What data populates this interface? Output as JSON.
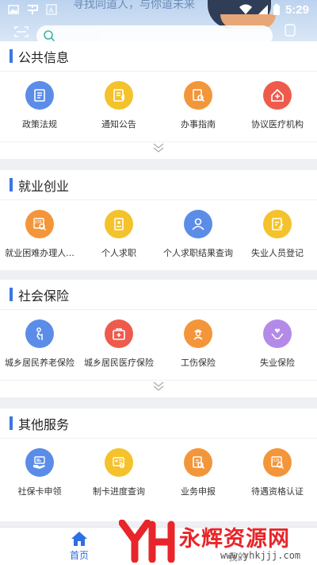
{
  "status_bar": {
    "time": "5:29"
  },
  "banner": {
    "slogan": "寻找同道人，与你道未来"
  },
  "search": {
    "placeholder": ""
  },
  "sections": [
    {
      "title": "公共信息",
      "has_more": true,
      "items": [
        {
          "label": "政策法规",
          "icon": "document-list-icon",
          "color": "#5b8de8"
        },
        {
          "label": "通知公告",
          "icon": "announcement-icon",
          "color": "#f4c22b"
        },
        {
          "label": "办事指南",
          "icon": "guide-search-icon",
          "color": "#f3963a"
        },
        {
          "label": "协议医疗机构",
          "icon": "hospital-house-icon",
          "color": "#ee5b4d"
        }
      ]
    },
    {
      "title": "就业创业",
      "has_more": false,
      "items": [
        {
          "label": "就业困难办理人...",
          "icon": "job-search-icon",
          "color": "#f3963a"
        },
        {
          "label": "个人求职",
          "icon": "resume-icon",
          "color": "#f4c22b"
        },
        {
          "label": "个人求职结果查询",
          "icon": "person-query-icon",
          "color": "#5b8de8"
        },
        {
          "label": "失业人员登记",
          "icon": "register-icon",
          "color": "#f4c22b"
        }
      ]
    },
    {
      "title": "社会保险",
      "has_more": true,
      "items": [
        {
          "label": "城乡居民养老保险",
          "icon": "elderly-icon",
          "color": "#5b8de8"
        },
        {
          "label": "城乡居民医疗保险",
          "icon": "medical-kit-icon",
          "color": "#ee5b4d"
        },
        {
          "label": "工伤保险",
          "icon": "worker-icon",
          "color": "#f3963a"
        },
        {
          "label": "失业保险",
          "icon": "heart-hands-icon",
          "color": "#b48ae8"
        }
      ]
    },
    {
      "title": "其他服务",
      "has_more": false,
      "items": [
        {
          "label": "社保卡申领",
          "icon": "card-hand-icon",
          "color": "#5b8de8"
        },
        {
          "label": "制卡进度查询",
          "icon": "card-progress-icon",
          "color": "#f4c22b"
        },
        {
          "label": "业务申报",
          "icon": "business-declare-icon",
          "color": "#f3963a"
        },
        {
          "label": "待遇资格认证",
          "icon": "qualification-icon",
          "color": "#f3963a"
        }
      ]
    }
  ],
  "bottom_nav": {
    "home": "首页",
    "mine": "我的"
  },
  "watermark": {
    "text": "永辉资源网",
    "url": "www.yhkjjj.com"
  },
  "colors": {
    "accent": "#3a76e6",
    "home_active": "#2f6fe2",
    "watermark": "#e8252a"
  }
}
